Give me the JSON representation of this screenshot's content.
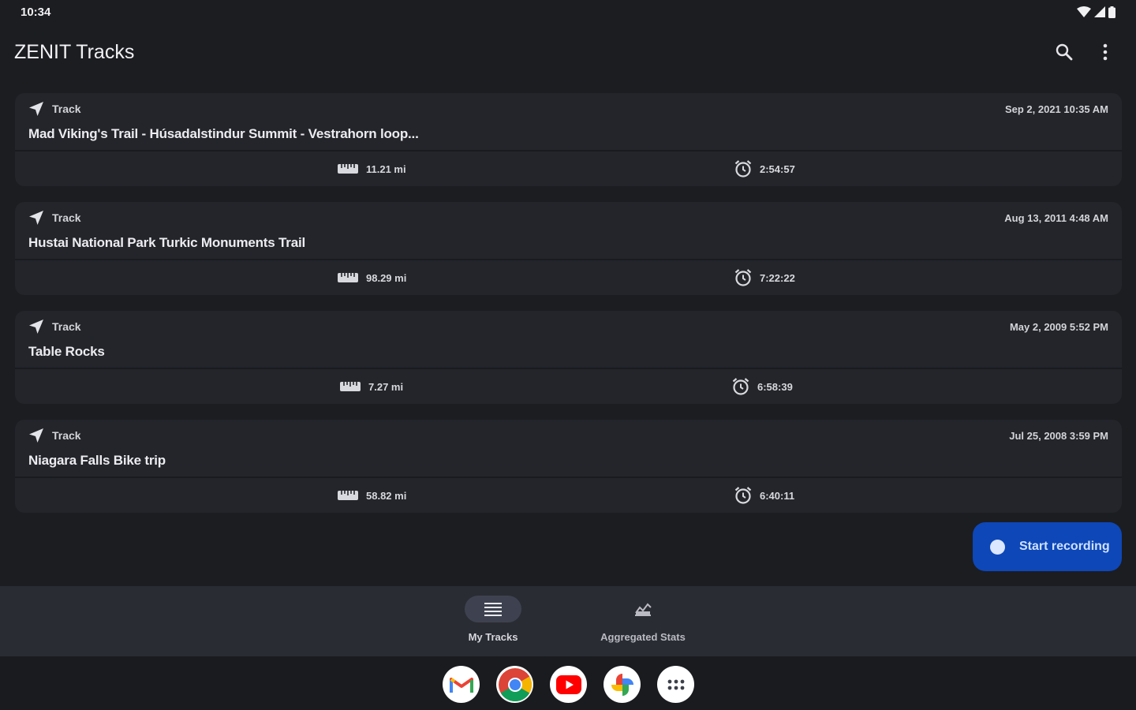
{
  "status_bar": {
    "time": "10:34"
  },
  "app_bar": {
    "title": "ZENIT Tracks",
    "search_icon": "search-icon",
    "menu_icon": "more-vert-icon"
  },
  "tracks": [
    {
      "type": "Track",
      "date": "Sep 2, 2021 10:35 AM",
      "name": "Mad Viking's Trail - Húsadalstindur Summit - Vestrahorn loop...",
      "distance": "11.21 mi",
      "duration": "2:54:57"
    },
    {
      "type": "Track",
      "date": "Aug 13, 2011 4:48 AM",
      "name": "Hustai National Park Turkic Monuments Trail",
      "distance": "98.29 mi",
      "duration": "7:22:22"
    },
    {
      "type": "Track",
      "date": "May 2, 2009 5:52 PM",
      "name": "Table Rocks",
      "distance": "7.27 mi",
      "duration": "6:58:39"
    },
    {
      "type": "Track",
      "date": "Jul 25, 2008 3:59 PM",
      "name": "Niagara Falls Bike trip",
      "distance": "58.82 mi",
      "duration": "6:40:11"
    }
  ],
  "fab": {
    "label": "Start recording"
  },
  "bottom_nav": {
    "items": [
      {
        "label": "My Tracks",
        "icon": "list-icon",
        "selected": true
      },
      {
        "label": "Aggregated Stats",
        "icon": "stats-icon",
        "selected": false
      }
    ]
  },
  "taskbar": {
    "apps": [
      "gmail-icon",
      "chrome-icon",
      "youtube-icon",
      "photos-icon",
      "app-drawer-icon"
    ]
  },
  "colors": {
    "background": "#1c1d21",
    "card": "#23252b",
    "fab": "#0d47b8",
    "nav": "#2a2c33"
  }
}
